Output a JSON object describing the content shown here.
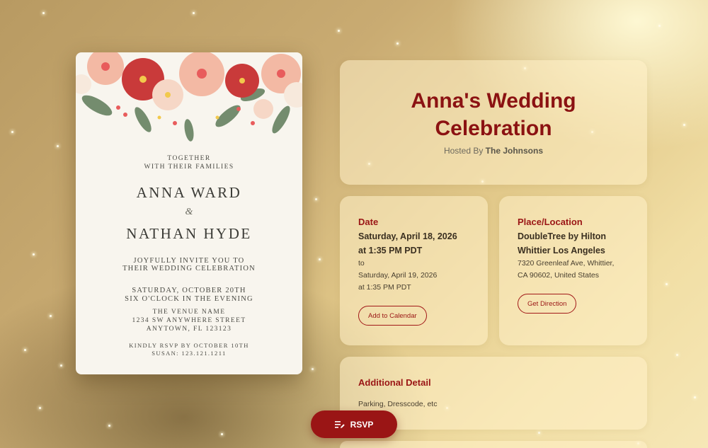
{
  "invitation": {
    "together": "TOGETHER",
    "families": "WITH THEIR FAMILIES",
    "bride": "ANNA WARD",
    "amp": "&",
    "groom": "NATHAN HYDE",
    "invite_line1": "JOYFULLY INVITE YOU TO",
    "invite_line2": "THEIR WEDDING CELEBRATION",
    "date_line": "SATURDAY, OCTOBER 20TH",
    "time_line": "SIX O'CLOCK IN THE EVENING",
    "venue_name": "THE VENUE NAME",
    "venue_street": "1234 SW ANYWHERE STREET",
    "venue_city": "ANYTOWN, FL 123123",
    "rsvp_line": "KINDLY RSVP BY OCTOBER 10TH",
    "rsvp_contact": "SUSAN: 123.121.1211"
  },
  "event": {
    "title_line1": "Anna's Wedding",
    "title_line2": "Celebration",
    "hosted_prefix": "Hosted By",
    "host": "The Johnsons"
  },
  "date_panel": {
    "label": "Date",
    "start_date": "Saturday, April 18, 2026",
    "start_time": "at 1:35 PM PDT",
    "to": "to",
    "end_date": "Saturday, April 19, 2026",
    "end_time": "at 1:35 PM PDT",
    "button": "Add to Calendar"
  },
  "place_panel": {
    "label": "Place/Location",
    "venue_line1": "DoubleTree by Hilton",
    "venue_line2": "Whittier Los Angeles",
    "address_line1": "7320 Greenleaf Ave, Whittier,",
    "address_line2": "CA 90602, United States",
    "button": "Get Direction"
  },
  "details_panel": {
    "label": "Additional Detail",
    "text": "Parking, Dresscode, etc"
  },
  "rsvp_button": {
    "label": "RSVP",
    "icon": "list-edit-icon"
  },
  "colors": {
    "accent": "#9a1515",
    "panel": "#ffefc8"
  }
}
